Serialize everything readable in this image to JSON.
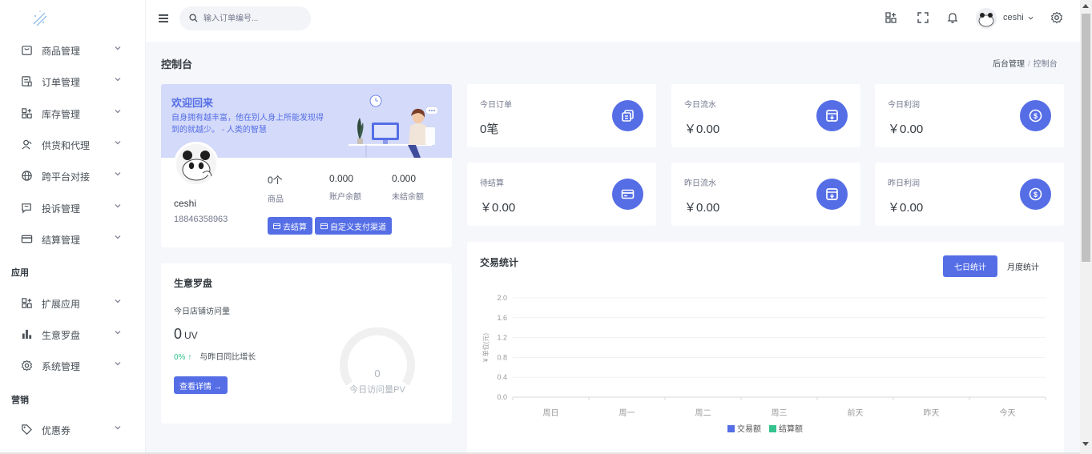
{
  "sidebar": {
    "items": [
      {
        "label": "商品管理",
        "icon": "shop-icon"
      },
      {
        "label": "订单管理",
        "icon": "order-icon"
      },
      {
        "label": "库存管理",
        "icon": "grid-icon"
      },
      {
        "label": "供货和代理",
        "icon": "user-icon"
      },
      {
        "label": "跨平台对接",
        "icon": "globe-icon"
      },
      {
        "label": "投诉管理",
        "icon": "message-icon"
      },
      {
        "label": "结算管理",
        "icon": "card-icon"
      }
    ],
    "section_apps": "应用",
    "app_items": [
      {
        "label": "扩展应用",
        "icon": "grid-icon"
      },
      {
        "label": "生意罗盘",
        "icon": "bar-chart-icon"
      },
      {
        "label": "系统管理",
        "icon": "gear-icon"
      }
    ],
    "section_marketing": "营销",
    "marketing_items": [
      {
        "label": "优惠券",
        "icon": "tag-icon"
      }
    ]
  },
  "topbar": {
    "search_placeholder": "输入订单编号...",
    "username": "ceshi"
  },
  "page": {
    "title": "控制台",
    "breadcrumb": [
      "后台管理",
      "控制台"
    ]
  },
  "welcome": {
    "title": "欢迎回来",
    "quote": "自身拥有越丰富，他在别人身上所能发现得到的就越少。 - 人类的智慧",
    "name": "ceshi",
    "phone": "18846358963",
    "stats": [
      {
        "value": "0个",
        "label": "商品"
      },
      {
        "value": "0.000",
        "label": "账户余额"
      },
      {
        "value": "0.000",
        "label": "未结余额"
      }
    ],
    "btn_settle": "去结算",
    "btn_payment": "自定义支付渠道"
  },
  "compass": {
    "title": "生意罗盘",
    "subtitle": "今日店铺访问量",
    "uv_value": "0",
    "uv_unit": "UV",
    "growth_pct": "0% ↑",
    "growth_text": "与昨日同比增长",
    "btn_details": "查看详情 →",
    "gauge_value": "0",
    "gauge_label": "今日访问量PV"
  },
  "stat_cards": [
    {
      "label": "今日订单",
      "value": "0笔",
      "icon": "copy-icon"
    },
    {
      "label": "今日流水",
      "value": "￥0.00",
      "icon": "archive-icon"
    },
    {
      "label": "今日利润",
      "value": "￥0.00",
      "icon": "dollar-icon"
    },
    {
      "label": "待结算",
      "value": "￥0.00",
      "icon": "card-icon"
    },
    {
      "label": "昨日流水",
      "value": "￥0.00",
      "icon": "archive-icon"
    },
    {
      "label": "昨日利润",
      "value": "￥0.00",
      "icon": "dollar-icon"
    }
  ],
  "chart_card": {
    "title": "交易统计",
    "tab_week": "七日统计",
    "tab_month": "月度统计"
  },
  "colors": {
    "accent": "#556ee6",
    "success": "#34c38f",
    "welcome_bg": "#d4daf9"
  },
  "chart_data": {
    "type": "bar",
    "categories": [
      "周日",
      "周一",
      "周二",
      "周三",
      "前天",
      "昨天",
      "今天"
    ],
    "series": [
      {
        "name": "交易额",
        "values": [
          0,
          0,
          0,
          0,
          0,
          0,
          0
        ],
        "color": "#556ee6"
      },
      {
        "name": "结算额",
        "values": [
          0,
          0,
          0,
          0,
          0,
          0,
          0
        ],
        "color": "#34c38f"
      }
    ],
    "ylabel": "¥ 单位(元)",
    "ylim": [
      0,
      2.0
    ],
    "yticks": [
      "0.0",
      "0.4",
      "0.8",
      "1.2",
      "1.6",
      "2.0"
    ],
    "grid": true,
    "legend": "bottom-center"
  }
}
